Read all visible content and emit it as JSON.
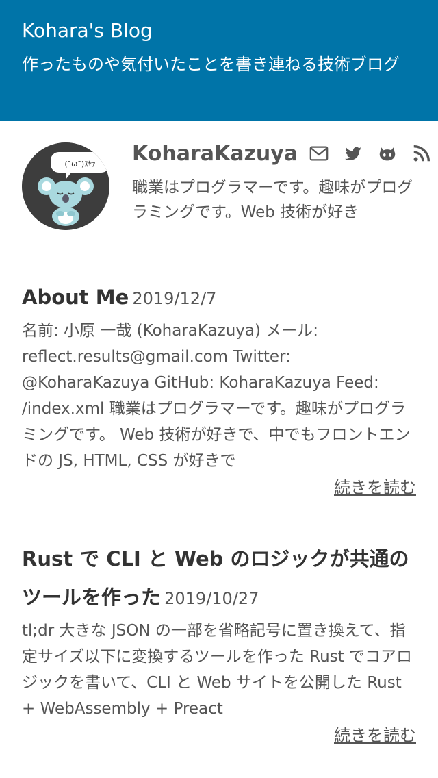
{
  "header": {
    "site_title": "Kohara's Blog",
    "subtitle": "作ったものや気付いたことを書き連ねる技術ブログ"
  },
  "profile": {
    "avatar_bubble_text": "(¯ω¯)ｽﾔｧ",
    "name": "KoharaKazuya",
    "icons": [
      "mail-icon",
      "twitter-icon",
      "github-icon",
      "rss-feed-icon"
    ],
    "description": "職業はプログラマーです。趣味がプログラミングです。Web 技術が好き"
  },
  "posts": [
    {
      "title": "About Me",
      "date": "2019/12/7",
      "excerpt": "名前: 小原 一哉 (KoharaKazuya) メール: reflect.results@gmail.com Twitter: @KoharaKazuya GitHub: KoharaKazuya Feed: /index.xml 職業はプログラマーです。趣味がプログラミングです。 Web 技術が好きで、中でもフロントエンドの JS, HTML, CSS が好きで",
      "read_more": "続きを読む"
    },
    {
      "title": "Rust で CLI と Web のロジックが共通のツールを作った",
      "date": "2019/10/27",
      "excerpt": "tl;dr 大きな JSON の一部を省略記号に置き換えて、指定サイズ以下に変換するツールを作った Rust でコアロジックを書いて、CLI と Web サイトを公開した Rust + WebAssembly + Preact",
      "read_more": "続きを読む"
    }
  ],
  "colors": {
    "header_bg": "#0074a8",
    "text": "#555555",
    "avatar_bg": "#3d3d3d",
    "koala": "#a9d9df"
  }
}
